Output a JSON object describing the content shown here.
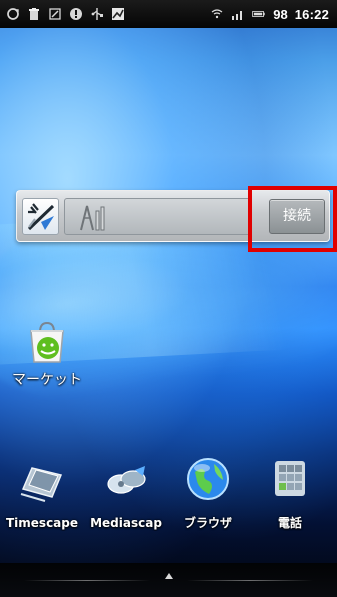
{
  "status_bar": {
    "time": "16:22",
    "battery_text": "98",
    "icons": [
      "sync-icon",
      "trash-icon",
      "warning-icon",
      "alert-icon",
      "usb-icon",
      "image-icon",
      "wifi-icon",
      "signal-icon",
      "battery-icon"
    ]
  },
  "widget": {
    "connect_label": "接続",
    "icon": "wireless-icon",
    "signal_icon": "signal-bars-icon"
  },
  "desktop": {
    "market_label": "マーケット",
    "market_icon": "market-icon"
  },
  "dock": {
    "items": [
      {
        "label": "Timescape",
        "icon": "timescape-icon"
      },
      {
        "label": "Mediascap",
        "icon": "mediascape-icon"
      },
      {
        "label": "ブラウザ",
        "icon": "browser-icon"
      },
      {
        "label": "電話",
        "icon": "phone-icon"
      }
    ]
  },
  "bottom_bar": {
    "handle_icon": "drawer-handle-icon"
  },
  "colors": {
    "highlight": "#e00000",
    "wallpaper_blue": "#2e8dfd",
    "status_bar": "#050505"
  }
}
